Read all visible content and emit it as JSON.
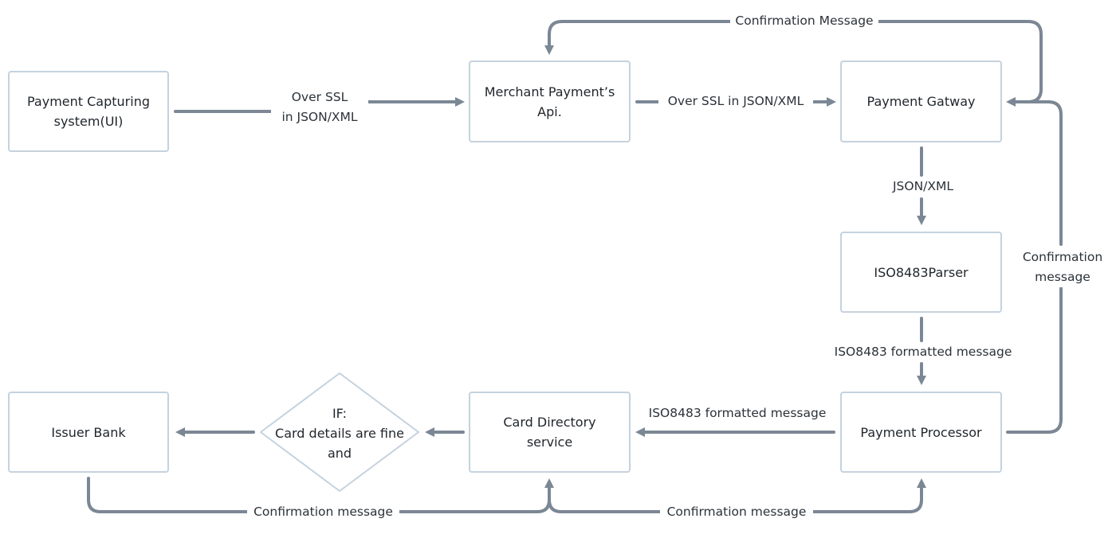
{
  "diagram": {
    "nodes": {
      "payment_capturing": {
        "label_line1": "Payment Capturing",
        "label_line2": "system(UI)"
      },
      "merchant_api": {
        "label_line1": "Merchant Payment’s",
        "label_line2": "Api."
      },
      "payment_gateway": {
        "label": "Payment Gatway"
      },
      "iso_parser": {
        "label": "ISO8483Parser"
      },
      "payment_processor": {
        "label": "Payment Processor"
      },
      "card_directory": {
        "label_line1": "Card Directory",
        "label_line2": "service"
      },
      "decision": {
        "label_line1": "IF:",
        "label_line2": "Card details are fine",
        "label_line3": "and"
      },
      "issuer_bank": {
        "label": "Issuer Bank"
      }
    },
    "edges": {
      "ui_to_merchant": {
        "label_line1": "Over SSL",
        "label_line2": "in JSON/XML"
      },
      "merchant_to_gateway": {
        "label": "Over SSL in JSON/XML"
      },
      "gateway_to_merchant": {
        "label": "Confirmation Message"
      },
      "gateway_to_parser": {
        "label": "JSON/XML"
      },
      "parser_to_processor": {
        "label": "ISO8483 formatted message"
      },
      "processor_to_gateway": {
        "label_line1": "Confirmation",
        "label_line2": "message"
      },
      "processor_to_directory": {
        "label": "ISO8483 formatted message"
      },
      "issuer_to_directory": {
        "label": "Confirmation message"
      },
      "directory_to_processor": {
        "label": "Confirmation message"
      }
    },
    "colors": {
      "edge": "#7b8794",
      "node_border": "#c5d2de",
      "text": "#1f252b"
    }
  }
}
